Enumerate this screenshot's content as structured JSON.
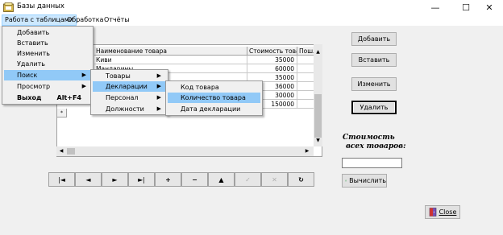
{
  "window": {
    "title": "Базы данных"
  },
  "menubar": [
    {
      "label": "Работа с таблицами"
    },
    {
      "label": "Обработка"
    },
    {
      "label": "Отчёты"
    }
  ],
  "menu_tables": [
    {
      "label": "Добавить"
    },
    {
      "label": "Вставить"
    },
    {
      "label": "Изменить"
    },
    {
      "label": "Удалить"
    },
    {
      "label": "Поиск",
      "submenu": true
    },
    {
      "label": "Просмотр",
      "submenu": true
    },
    {
      "label": "Выход",
      "shortcut": "Alt+F4"
    }
  ],
  "menu_search": [
    {
      "label": "Товары",
      "submenu": true
    },
    {
      "label": "Декларации",
      "submenu": true
    },
    {
      "label": "Персонал",
      "submenu": true
    },
    {
      "label": "Должности",
      "submenu": true
    }
  ],
  "menu_declarations": [
    {
      "label": "Код товара"
    },
    {
      "label": "Количество товара"
    },
    {
      "label": "Дата декларации"
    }
  ],
  "grid": {
    "columns": [
      "Наименование товара",
      "Стоимость товара",
      "Пошл"
    ],
    "rows": [
      {
        "name": "Киви",
        "cost": "35000"
      },
      {
        "name": "Мандарины",
        "cost": "60000"
      },
      {
        "name": "",
        "cost": "35000"
      },
      {
        "name": "",
        "cost": "36000"
      },
      {
        "name": "",
        "cost": "30000"
      },
      {
        "name": "",
        "cost": "150000"
      }
    ]
  },
  "buttons": {
    "add": "Добавить",
    "insert": "Вставить",
    "edit": "Изменить",
    "delete": "Удалить",
    "calculate": "Вычислить",
    "close": "Close"
  },
  "total": {
    "label_line1": "Стоимость",
    "label_line2": "всех товаров:",
    "value": ""
  },
  "navigator": [
    "|◄",
    "◄",
    "►",
    "►|",
    "+",
    "−",
    "▲",
    "✓",
    "✕",
    "↻"
  ],
  "colors": {
    "menu_highlight": "#91c9f7",
    "menubar_selected": "#cce8ff"
  }
}
